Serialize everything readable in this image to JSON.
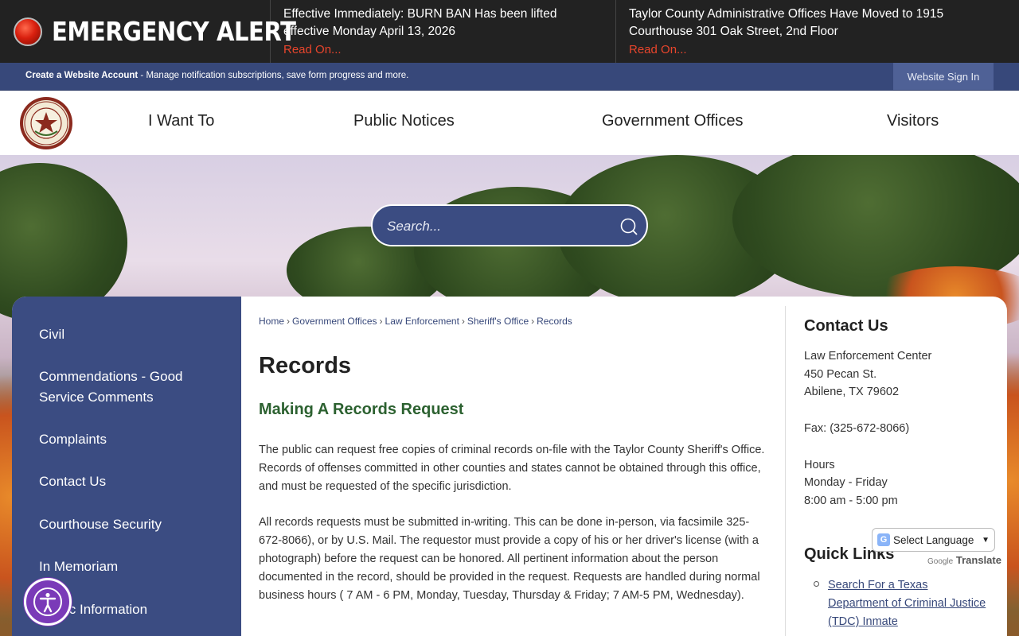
{
  "alert": {
    "label": "EMERGENCY ALERT",
    "items": [
      {
        "text": "Effective Immediately: BURN BAN Has been lifted effective Monday April 13, 2026",
        "link": "Read On..."
      },
      {
        "text": "Taylor County Administrative Offices Have Moved to 1915 Courthouse 301 Oak Street, 2nd Floor",
        "link": "Read On..."
      }
    ]
  },
  "account": {
    "create_label": "Create a Website Account",
    "description": " - Manage notification subscriptions, save form progress and more.",
    "signin_label": "Website Sign In"
  },
  "nav": {
    "items": [
      "I Want To",
      "Public Notices",
      "Government Offices",
      "Visitors"
    ]
  },
  "search": {
    "placeholder": "Search..."
  },
  "sidebar": {
    "items": [
      "Civil",
      "Commendations - Good Service Comments",
      "Complaints",
      "Contact Us",
      "Courthouse Security",
      "In Memoriam",
      "Public Information"
    ]
  },
  "breadcrumb": [
    "Home",
    "Government Offices",
    "Law Enforcement",
    "Sheriff's Office",
    "Records"
  ],
  "main": {
    "title": "Records",
    "subhead": "Making A Records Request",
    "paragraphs": [
      "The public can request free copies of criminal records on-file with the Taylor County Sheriff's Office. Records of offenses committed in other counties and states cannot be obtained through this office, and must be requested of the specific jurisdiction.",
      "All records requests must be submitted in-writing. This can be done in-person, via facsimile 325-672-8066), or by U.S. Mail. The requestor must provide a copy of his or her driver's license (with a photograph) before the request can be honored. All pertinent information about the person documented in the record, should be provided in the request. Requests are handled during normal business hours ( 7 AM - 6 PM, Monday, Tuesday, Thursday & Friday; 7 AM-5 PM, Wednesday)."
    ]
  },
  "contact": {
    "heading": "Contact Us",
    "lines": [
      "Law Enforcement Center",
      "450 Pecan St.",
      "Abilene, TX 79602"
    ],
    "fax": "Fax: (325-672-8066)",
    "hours_label": "Hours",
    "hours_days": "Monday - Friday",
    "hours_time": "8:00 am - 5:00 pm"
  },
  "quick_links": {
    "heading": "Quick Links",
    "items": [
      "Search For a Texas Department of Criminal Justice (TDC) Inmate"
    ]
  },
  "translate": {
    "select_label": "Select Language",
    "powered_by": "Google",
    "translate_word": "Translate"
  },
  "colors": {
    "brand_blue": "#3b4c82",
    "alert_red": "#e8452c",
    "subhead_green": "#2c6130"
  }
}
